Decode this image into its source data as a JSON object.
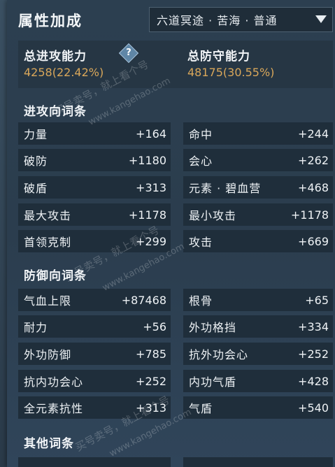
{
  "panel": {
    "title": "属性加成",
    "dropdown": {
      "selected": "六道冥途 · 苦海 · 普通",
      "icon": "chevron-down-icon"
    }
  },
  "summary": {
    "attack_label": "总进攻能力",
    "attack_value": "4258(22.42%)",
    "defense_label": "总防守能力",
    "defense_value": "48175(30.55%)",
    "help_icon": "?"
  },
  "sections": {
    "attack": "进攻向词条",
    "defense": "防御向词条",
    "other": "其他词条"
  },
  "attack_stats": [
    {
      "name": "力量",
      "value": "+164"
    },
    {
      "name": "命中",
      "value": "+244"
    },
    {
      "name": "破防",
      "value": "+1180"
    },
    {
      "name": "会心",
      "value": "+262"
    },
    {
      "name": "破盾",
      "value": "+313"
    },
    {
      "name": "元素 · 碧血营",
      "value": "+468"
    },
    {
      "name": "最大攻击",
      "value": "+1178"
    },
    {
      "name": "最小攻击",
      "value": "+1178"
    },
    {
      "name": "首领克制",
      "value": "+299"
    },
    {
      "name": "攻击",
      "value": "+669"
    }
  ],
  "defense_stats": [
    {
      "name": "气血上限",
      "value": "+87468"
    },
    {
      "name": "根骨",
      "value": "+65"
    },
    {
      "name": "耐力",
      "value": "+56"
    },
    {
      "name": "外功格挡",
      "value": "+334"
    },
    {
      "name": "外功防御",
      "value": "+785"
    },
    {
      "name": "抗外功会心",
      "value": "+252"
    },
    {
      "name": "抗内功会心",
      "value": "+252"
    },
    {
      "name": "内功气盾",
      "value": "+428"
    },
    {
      "name": "全元素抗性",
      "value": "+313"
    },
    {
      "name": "气盾",
      "value": "+540"
    }
  ],
  "watermarks": [
    "买号卖号，就上看个号",
    "www.kangehao.com",
    "看个号"
  ],
  "colors": {
    "accent_gold": "#d9a75a",
    "cell_bg": "#1f2e3b",
    "panel_bg": "#2c3f50"
  }
}
